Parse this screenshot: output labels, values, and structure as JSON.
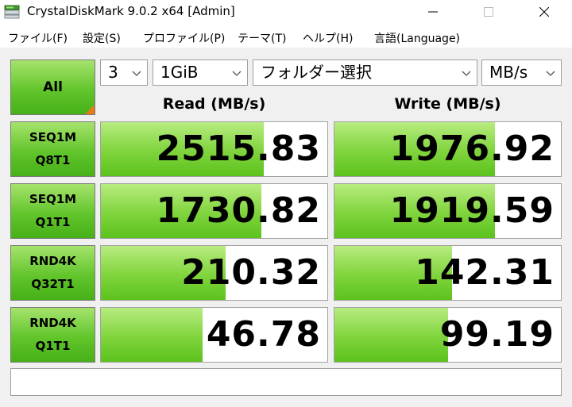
{
  "window": {
    "title": "CrystalDiskMark 9.0.2 x64 [Admin]"
  },
  "menu": [
    {
      "label": "ファイル(F)"
    },
    {
      "label": "設定(S)"
    },
    {
      "label": "プロファイル(P)"
    },
    {
      "label": "テーマ(T)"
    },
    {
      "label": "ヘルプ(H)"
    },
    {
      "label": "言語(Language)"
    }
  ],
  "controls": {
    "all_label": "All",
    "count": "3",
    "size": "1GiB",
    "target": "フォルダー選択",
    "unit": "MB/s"
  },
  "headers": {
    "read": "Read (MB/s)",
    "write": "Write (MB/s)"
  },
  "tests": [
    {
      "line1": "SEQ1M",
      "line2": "Q8T1",
      "read": "2515.83",
      "write": "1976.92",
      "read_fill": 0.72,
      "write_fill": 0.71
    },
    {
      "line1": "SEQ1M",
      "line2": "Q1T1",
      "read": "1730.82",
      "write": "1919.59",
      "read_fill": 0.71,
      "write_fill": 0.71
    },
    {
      "line1": "RND4K",
      "line2": "Q32T1",
      "read": "210.32",
      "write": "142.31",
      "read_fill": 0.55,
      "write_fill": 0.52
    },
    {
      "line1": "RND4K",
      "line2": "Q1T1",
      "read": "46.78",
      "write": "99.19",
      "read_fill": 0.45,
      "write_fill": 0.5
    }
  ],
  "comment": "",
  "colors": {
    "accent_green": "#62c52c",
    "corner_orange": "#e87a1a"
  }
}
